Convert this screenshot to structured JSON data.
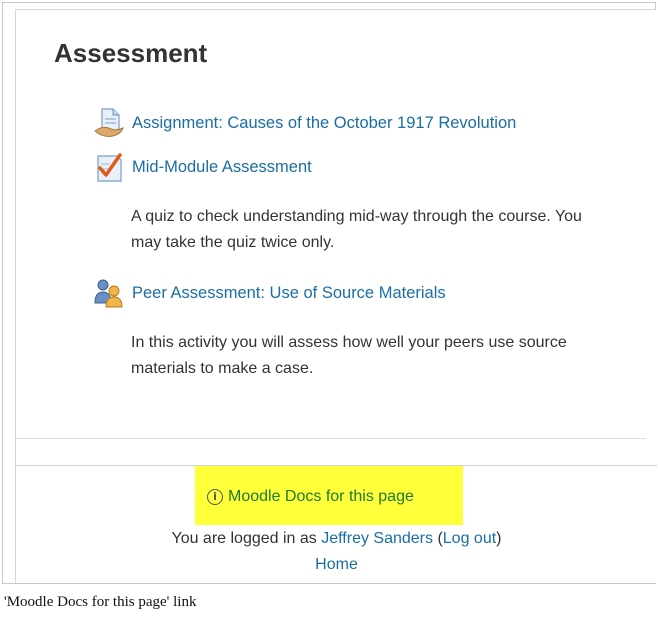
{
  "section": {
    "title": "Assessment"
  },
  "activities": [
    {
      "label": "Assignment: Causes of the October 1917 Revolution",
      "icon": "assignment-icon"
    },
    {
      "label": "Mid-Module Assessment",
      "icon": "quiz-icon",
      "description": "A quiz to check understanding mid-way through the course. You may take the quiz twice only."
    },
    {
      "label": "Peer Assessment: Use of Source Materials",
      "icon": "workshop-icon",
      "description": "In this activity you will assess how well your peers use source materials to make a case."
    }
  ],
  "footer": {
    "docs_link": "Moodle Docs for this page",
    "logged_in_prefix": "You are logged in as ",
    "user_name": "Jeffrey Sanders",
    "paren_open": " (",
    "logout": "Log out",
    "paren_close": ")",
    "home": "Home"
  },
  "caption": "'Moodle Docs for this page' link",
  "colors": {
    "link": "#1a6ea5",
    "highlight": "#ffff3a",
    "docs_link": "#1f7a35"
  }
}
